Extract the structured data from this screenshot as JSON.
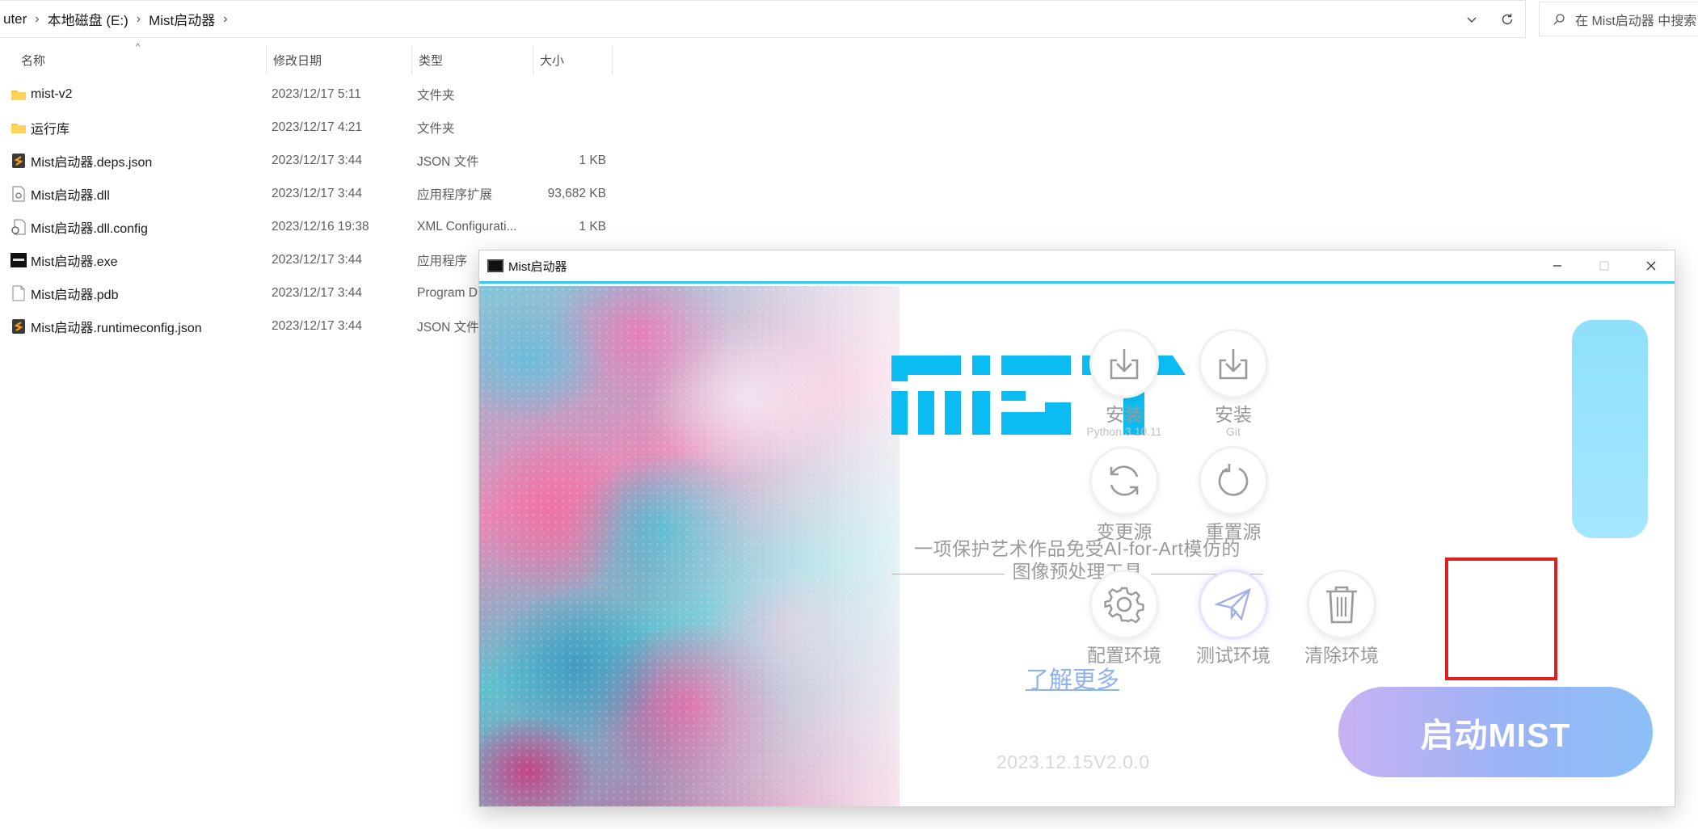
{
  "explorer": {
    "breadcrumb": [
      "uter",
      "本地磁盘 (E:)",
      "Mist启动器"
    ],
    "search_placeholder": "在 Mist启动器 中搜索",
    "columns": {
      "name": "名称",
      "date": "修改日期",
      "type": "类型",
      "size": "大小"
    },
    "files": [
      {
        "icon": "folder-icon",
        "name": "mist-v2",
        "date": "2023/12/17 5:11",
        "type": "文件夹",
        "size": ""
      },
      {
        "icon": "folder-icon",
        "name": "运行库",
        "date": "2023/12/17 4:21",
        "type": "文件夹",
        "size": ""
      },
      {
        "icon": "json-file-icon",
        "name": "Mist启动器.deps.json",
        "date": "2023/12/17 3:44",
        "type": "JSON 文件",
        "size": "1 KB"
      },
      {
        "icon": "dll-file-icon",
        "name": "Mist启动器.dll",
        "date": "2023/12/17 3:44",
        "type": "应用程序扩展",
        "size": "93,682 KB"
      },
      {
        "icon": "config-file-icon",
        "name": "Mist启动器.dll.config",
        "date": "2023/12/16 19:38",
        "type": "XML Configurati...",
        "size": "1 KB"
      },
      {
        "icon": "exe-file-icon",
        "name": "Mist启动器.exe",
        "date": "2023/12/17 3:44",
        "type": "应用程序",
        "size": ""
      },
      {
        "icon": "pdb-file-icon",
        "name": "Mist启动器.pdb",
        "date": "2023/12/17 3:44",
        "type": "Program D",
        "size": ""
      },
      {
        "icon": "json-file-icon",
        "name": "Mist启动器.runtimeconfig.json",
        "date": "2023/12/17 3:44",
        "type": "JSON 文件",
        "size": ""
      }
    ]
  },
  "mist": {
    "window_title": "Mist启动器",
    "logo_text": "MIST",
    "tagline_line1": "一项保护艺术作品免受AI-for-Art模仿的",
    "tagline_line2": "图像预处理工具",
    "learn_more": "了解更多",
    "version": "2023.12.15V2.0.0",
    "tools": {
      "install_python": {
        "label": "安装",
        "sub": "Python 3.10.11"
      },
      "install_git": {
        "label": "安装",
        "sub": "Git"
      },
      "change_source": {
        "label": "变更源"
      },
      "reset_source": {
        "label": "重置源"
      },
      "config_env": {
        "label": "配置环境"
      },
      "test_env": {
        "label": "测试环境"
      },
      "clear_env": {
        "label": "清除环境"
      }
    },
    "launch_button": "启动MIST",
    "colors": {
      "accent": "#0bbcf2",
      "launch_gradient_start": "#c7b2f3",
      "launch_gradient_end": "#8cc0f7",
      "highlight": "#e11f1f"
    }
  }
}
